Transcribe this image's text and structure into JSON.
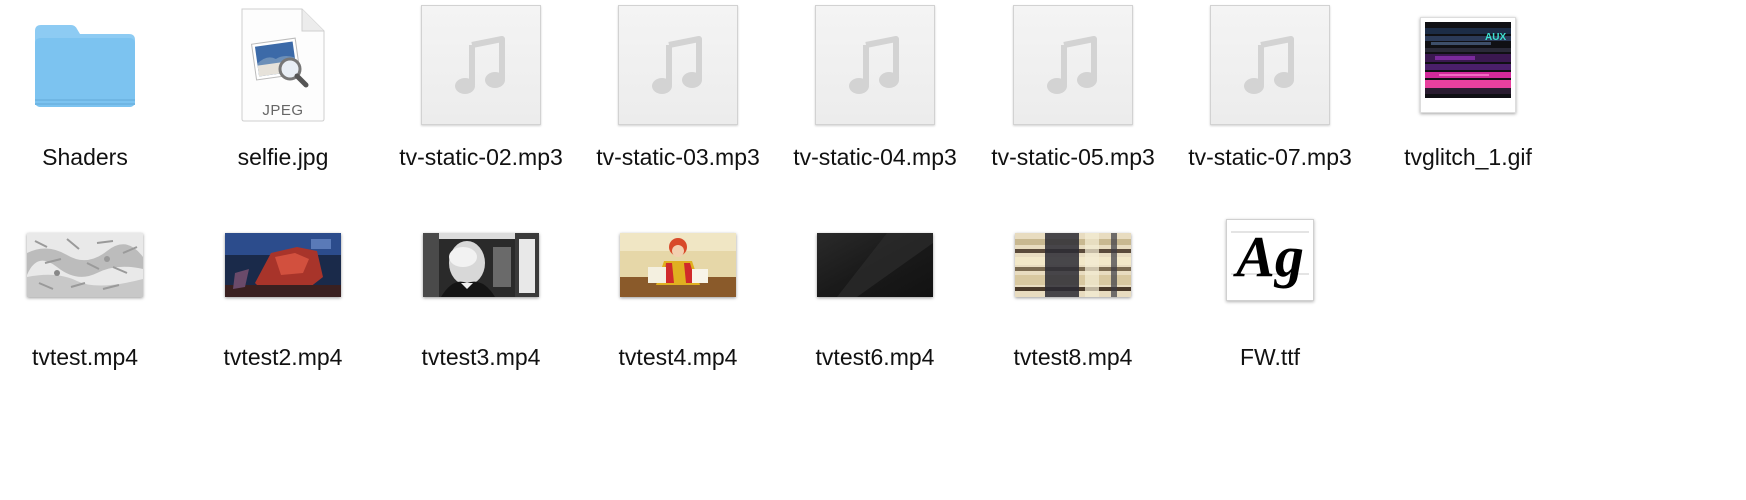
{
  "files": [
    {
      "name": "Shaders",
      "kind": "folder",
      "icon": "folder-icon"
    },
    {
      "name": "selfie.jpg",
      "kind": "jpeg",
      "icon": "jpeg-file-icon",
      "badge": "JPEG"
    },
    {
      "name": "tv-static-02.mp3",
      "kind": "audio",
      "icon": "music-note-icon"
    },
    {
      "name": "tv-static-03.mp3",
      "kind": "audio",
      "icon": "music-note-icon"
    },
    {
      "name": "tv-static-04.mp3",
      "kind": "audio",
      "icon": "music-note-icon"
    },
    {
      "name": "tv-static-05.mp3",
      "kind": "audio",
      "icon": "music-note-icon"
    },
    {
      "name": "tv-static-07.mp3",
      "kind": "audio",
      "icon": "music-note-icon"
    },
    {
      "name": "tvglitch_1.gif",
      "kind": "gif",
      "icon": "gif-thumbnail",
      "thumb_text": "AUX"
    },
    {
      "name": "tvtest.mp4",
      "kind": "video",
      "icon": "video-thumbnail"
    },
    {
      "name": "tvtest2.mp4",
      "kind": "video",
      "icon": "video-thumbnail"
    },
    {
      "name": "tvtest3.mp4",
      "kind": "video",
      "icon": "video-thumbnail"
    },
    {
      "name": "tvtest4.mp4",
      "kind": "video",
      "icon": "video-thumbnail"
    },
    {
      "name": "tvtest6.mp4",
      "kind": "video",
      "icon": "video-thumbnail"
    },
    {
      "name": "tvtest8.mp4",
      "kind": "video",
      "icon": "video-thumbnail"
    },
    {
      "name": "FW.ttf",
      "kind": "font",
      "icon": "font-file-icon",
      "glyph": "Ag"
    }
  ],
  "colors": {
    "folder": "#7cc3f0",
    "folder_tab": "#9fd3f5",
    "audio_bg": "#efefef",
    "note": "#d4d4d4",
    "label": "#111111"
  }
}
